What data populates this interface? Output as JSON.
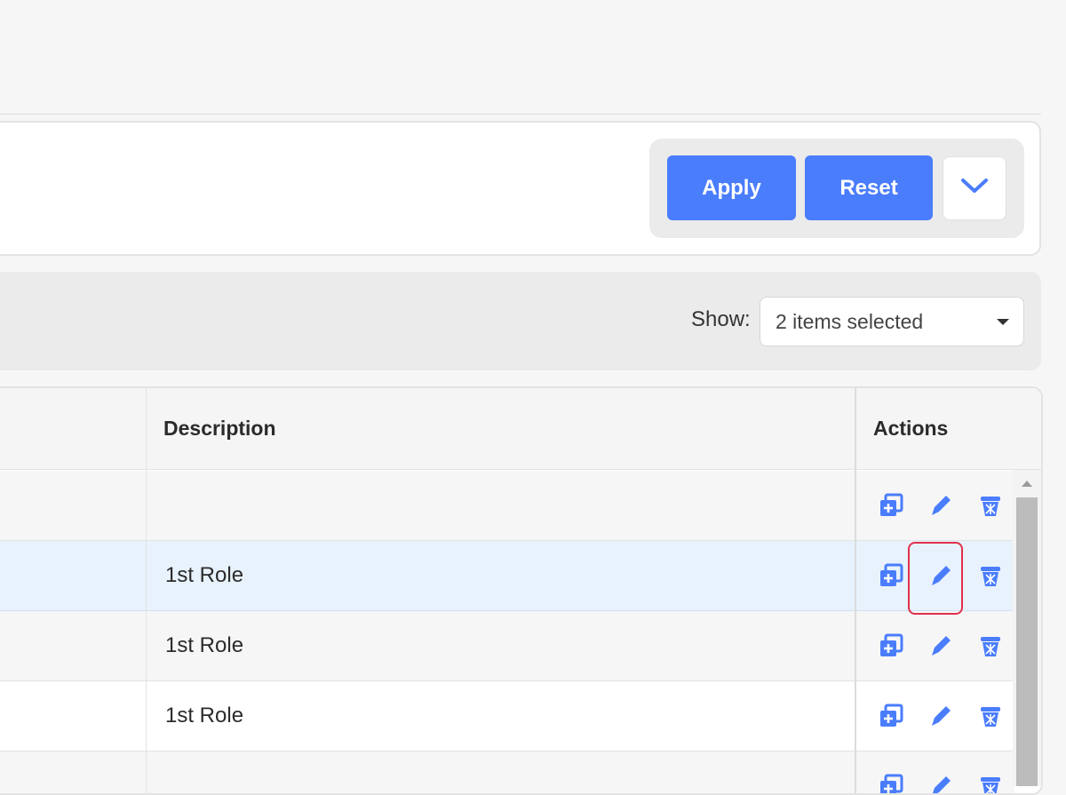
{
  "filter": {
    "apply_label": "Apply",
    "reset_label": "Reset",
    "expand_icon": "chevron-down-icon"
  },
  "toolbar": {
    "show_label": "Show:",
    "show_value": "2 items selected"
  },
  "table": {
    "headers": {
      "description": "Description",
      "actions": "Actions"
    },
    "rows": [
      {
        "description": ""
      },
      {
        "description": "1st Role"
      },
      {
        "description": "1st Role"
      },
      {
        "description": "1st Role"
      },
      {
        "description": ""
      }
    ],
    "action_icons": [
      "duplicate-icon",
      "edit-icon",
      "delete-icon"
    ]
  },
  "colors": {
    "accent": "#4a7dfc",
    "highlight_row": "#e7f2fc",
    "focus_outline": "#e0314b"
  }
}
